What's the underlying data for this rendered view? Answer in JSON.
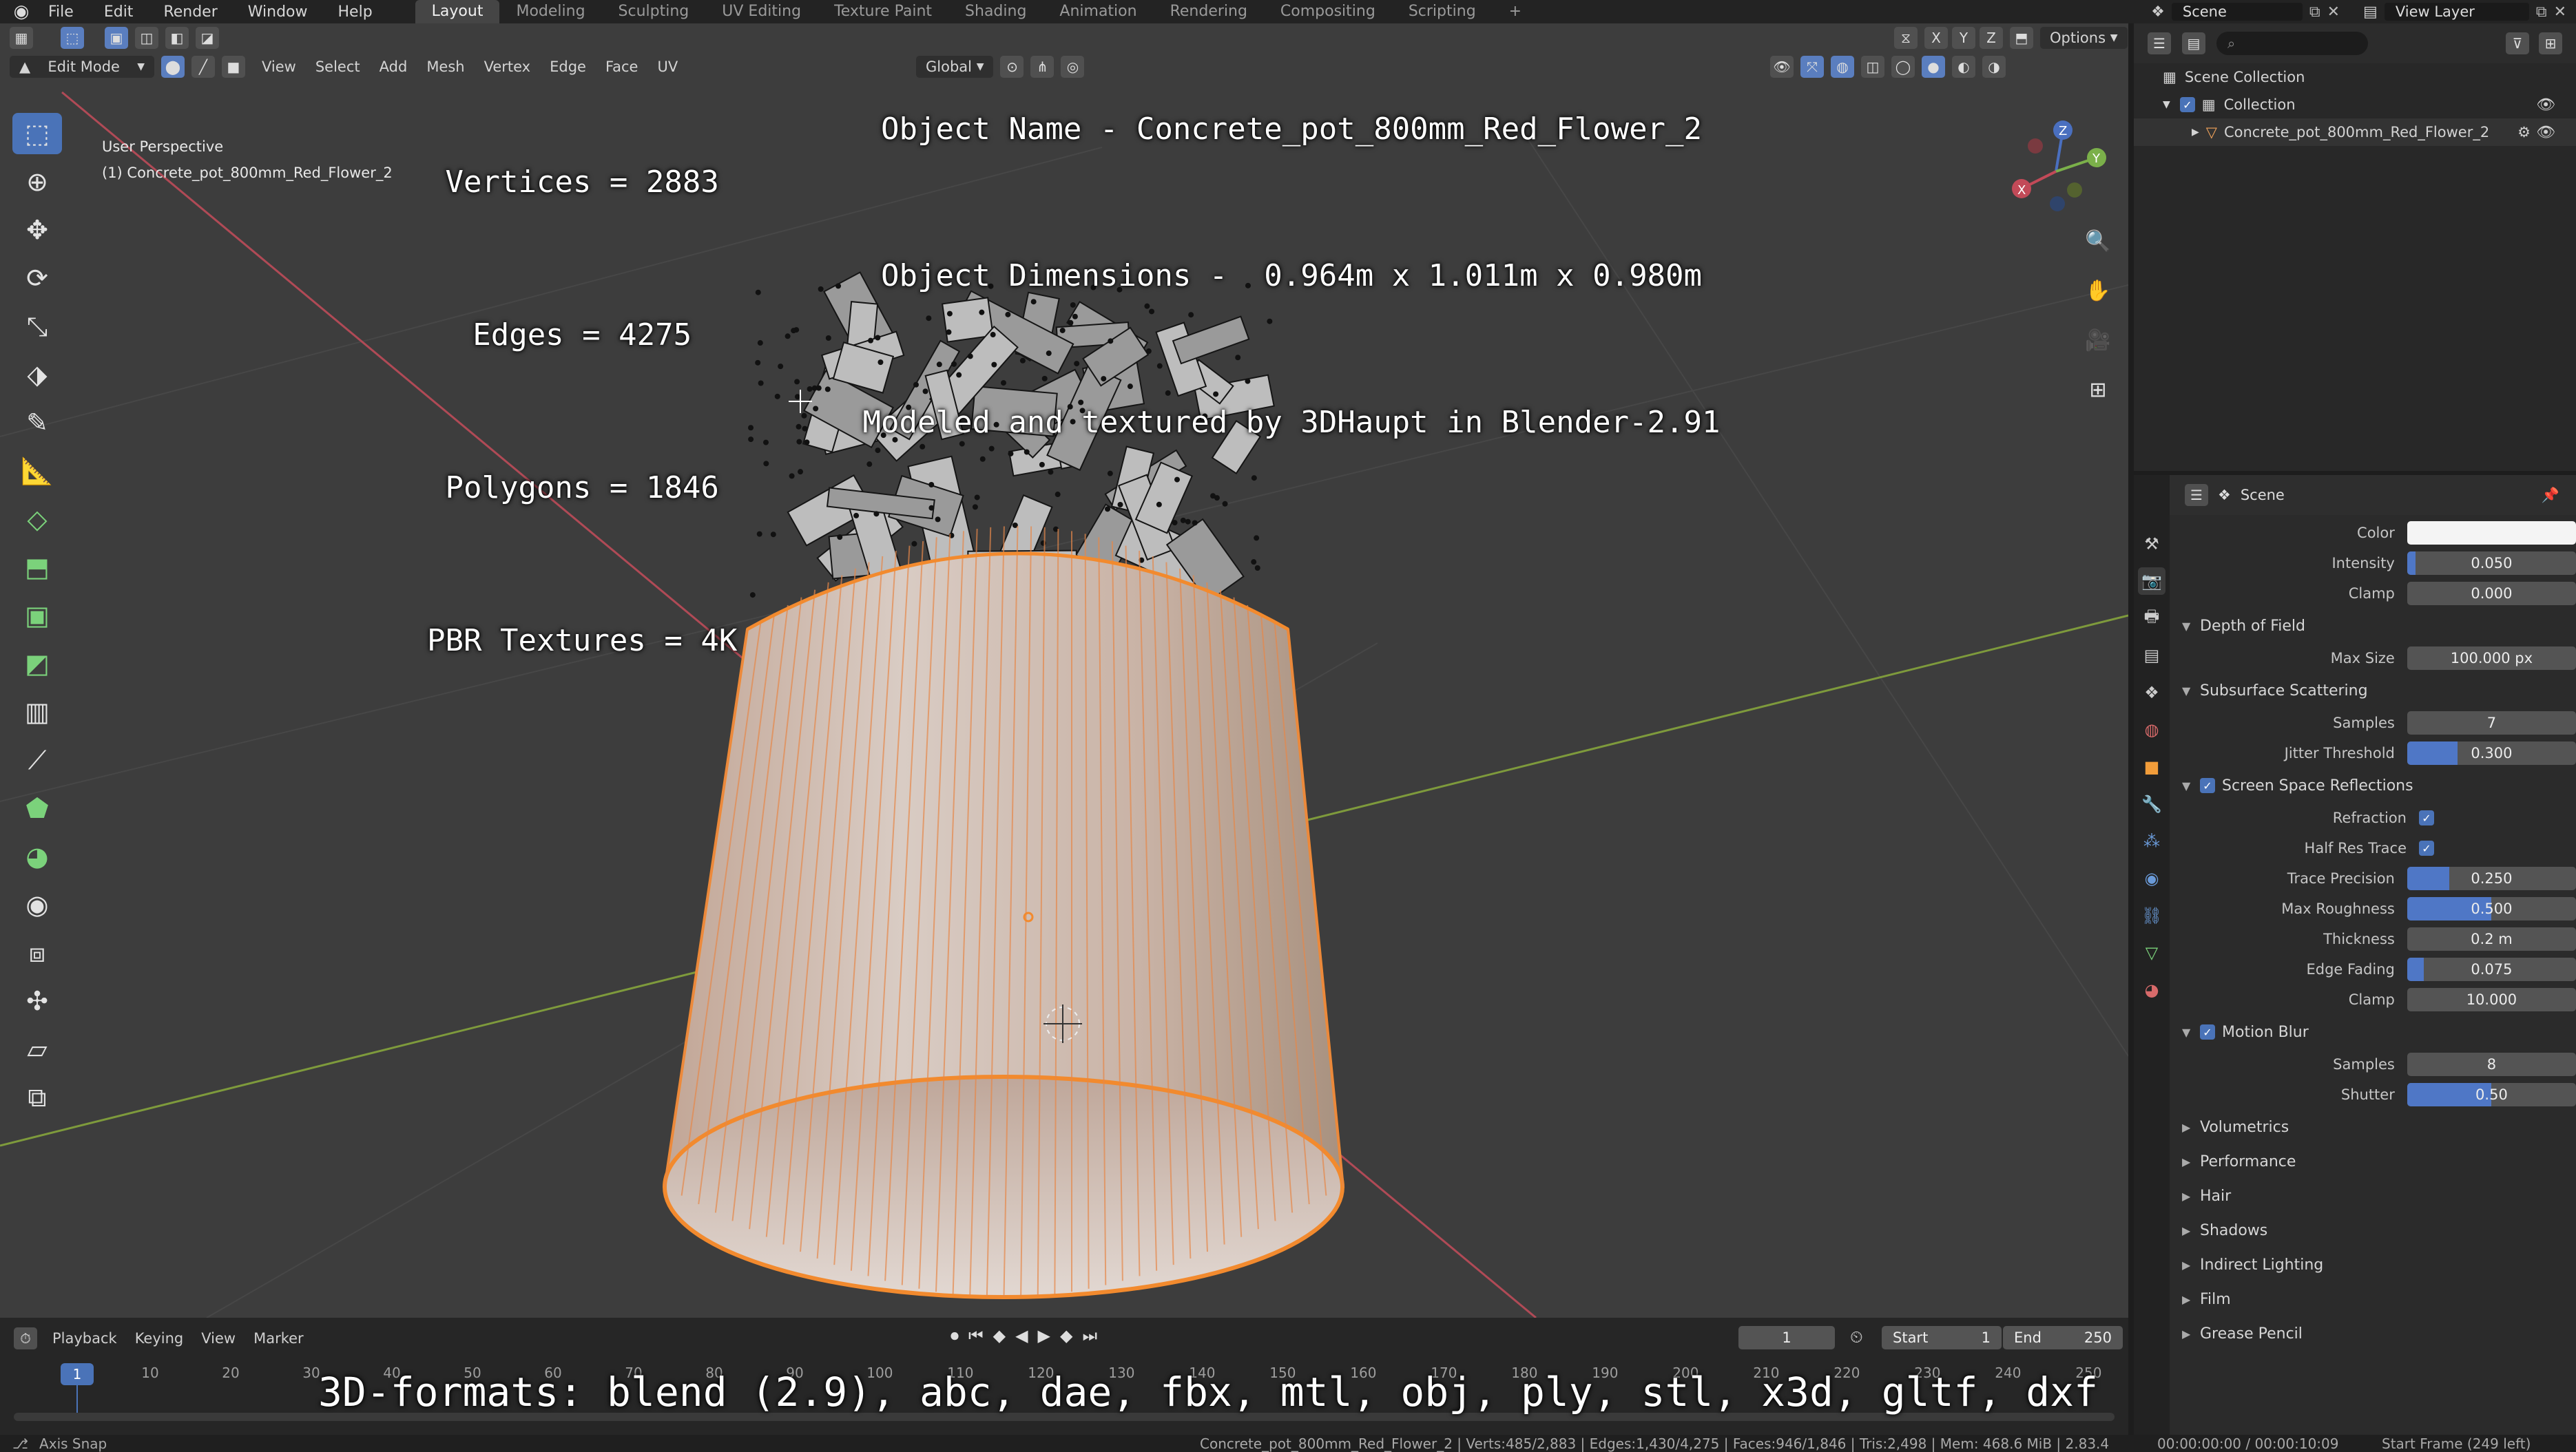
{
  "menubar": {
    "items": [
      "File",
      "Edit",
      "Render",
      "Window",
      "Help"
    ],
    "workspace_tabs": [
      "Layout",
      "Modeling",
      "Sculpting",
      "UV Editing",
      "Texture Paint",
      "Shading",
      "Animation",
      "Rendering",
      "Compositing",
      "Scripting"
    ],
    "active_tab": "Layout",
    "scene_label": "Scene",
    "view_layer_label": "View Layer"
  },
  "viewport": {
    "mode": "Edit Mode",
    "menu": [
      "View",
      "Select",
      "Add",
      "Mesh",
      "Vertex",
      "Edge",
      "Face",
      "UV"
    ],
    "transform_orientation": "Global",
    "options_label": "Options",
    "axis_buttons": [
      "X",
      "Y",
      "Z"
    ],
    "perspective_label": "User Perspective",
    "object_label": "(1) Concrete_pot_800mm_Red_Flower_2",
    "gizmo_axes": [
      "X",
      "Y",
      "Z"
    ]
  },
  "overlay": {
    "stats": [
      "Vertices = 2883",
      "Edges = 4275",
      "Polygons = 1846",
      "PBR Textures = 4K"
    ],
    "object_name": "Object Name - Concrete_pot_800mm_Red_Flower_2",
    "object_dimensions": "Object Dimensions -  0.964m x 1.011m x 0.980m",
    "credit": "Modeled and textured by 3DHaupt in Blender-2.91",
    "formats": "3D-formats: blend (2.9), abc, dae, fbx, mtl, obj, ply, stl, x3d, gltf, dxf"
  },
  "outliner": {
    "search_placeholder": "",
    "items": [
      {
        "label": "Scene Collection",
        "depth": 0
      },
      {
        "label": "Collection",
        "depth": 1
      },
      {
        "label": "Concrete_pot_800mm_Red_Flower_2",
        "depth": 2
      }
    ]
  },
  "properties": {
    "context": "Scene",
    "rows_top": [
      {
        "label": "Color",
        "value": "",
        "type": "color"
      },
      {
        "label": "Intensity",
        "value": "0.050",
        "fill": 0.05
      },
      {
        "label": "Clamp",
        "value": "0.000",
        "fill": 0
      }
    ],
    "sections": [
      {
        "title": "Depth of Field",
        "open": true,
        "check": false,
        "rows": [
          {
            "label": "Max Size",
            "value": "100.000 px",
            "fill": 0
          }
        ]
      },
      {
        "title": "Subsurface Scattering",
        "open": true,
        "check": false,
        "rows": [
          {
            "label": "Samples",
            "value": "7",
            "fill": 0
          },
          {
            "label": "Jitter Threshold",
            "value": "0.300",
            "fill": 0.3
          }
        ]
      },
      {
        "title": "Screen Space Reflections",
        "open": true,
        "check": true,
        "rows": [
          {
            "label": "Refraction",
            "value": "",
            "check": true
          },
          {
            "label": "Half Res Trace",
            "value": "",
            "check": true
          },
          {
            "label": "Trace Precision",
            "value": "0.250",
            "fill": 0.25
          },
          {
            "label": "Max Roughness",
            "value": "0.500",
            "fill": 0.5
          },
          {
            "label": "Thickness",
            "value": "0.2 m",
            "fill": 0
          },
          {
            "label": "Edge Fading",
            "value": "0.075",
            "fill": 0.1
          },
          {
            "label": "Clamp",
            "value": "10.000",
            "fill": 0
          }
        ]
      },
      {
        "title": "Motion Blur",
        "open": true,
        "check": true,
        "rows": [
          {
            "label": "Samples",
            "value": "8",
            "fill": 0
          },
          {
            "label": "Shutter",
            "value": "0.50",
            "fill": 0.5
          }
        ]
      },
      {
        "title": "Volumetrics",
        "open": false,
        "check": false,
        "rows": []
      },
      {
        "title": "Performance",
        "open": false,
        "check": false,
        "rows": []
      },
      {
        "title": "Hair",
        "open": false,
        "check": false,
        "rows": []
      },
      {
        "title": "Shadows",
        "open": false,
        "check": false,
        "rows": []
      },
      {
        "title": "Indirect Lighting",
        "open": false,
        "check": false,
        "rows": []
      },
      {
        "title": "Film",
        "open": false,
        "check": false,
        "rows": []
      },
      {
        "title": "Grease Pencil",
        "open": false,
        "check": false,
        "rows": []
      }
    ]
  },
  "timeline": {
    "menu": [
      "Playback",
      "Keying",
      "View",
      "Marker"
    ],
    "current_frame": "1",
    "start_label": "Start",
    "start_value": "1",
    "end_label": "End",
    "end_value": "250",
    "ticks": [
      "1",
      "10",
      "20",
      "30",
      "40",
      "50",
      "60",
      "70",
      "80",
      "90",
      "100",
      "110",
      "120",
      "130",
      "140",
      "150",
      "160",
      "170",
      "180",
      "190",
      "200",
      "210",
      "220",
      "230",
      "240",
      "250"
    ]
  },
  "statusbar": {
    "left": "Axis Snap",
    "stats": "Concrete_pot_800mm_Red_Flower_2 | Verts:485/2,883 | Edges:1,430/4,275 | Faces:946/1,846 | Tris:2,498 | Mem: 468.6 MiB | 2.83.4",
    "time": "00:00:00:00 / 00:00:10:09",
    "frame_info": "Start Frame (249 left)"
  },
  "colors": {
    "accent": "#4a73b8",
    "selection": "#f28a2e",
    "viewport_bg": "#3d3d3d"
  }
}
